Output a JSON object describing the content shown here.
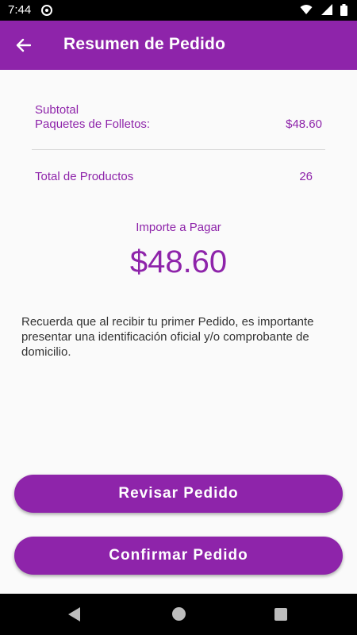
{
  "status_bar": {
    "time": "7:44",
    "icons": [
      "app-notification-icon",
      "wifi-icon",
      "signal-icon",
      "battery-icon"
    ]
  },
  "app_bar": {
    "title": "Resumen de Pedido",
    "back_icon": "arrow-back-icon",
    "background_color": "#8e24aa"
  },
  "summary": {
    "subtotal_label": "Subtotal",
    "packages_label": "Paquetes de Folletos:",
    "packages_amount": "$48.60",
    "total_products_label": "Total de Productos",
    "total_products_value": "26"
  },
  "payment": {
    "caption": "Importe a Pagar",
    "amount": "$48.60"
  },
  "notice": {
    "text": "Recuerda que al recibir tu primer Pedido, es importante presentar una identificación oficial y/o comprobante de domicilio."
  },
  "actions": {
    "review_label": "Revisar Pedido",
    "confirm_label": "Confirmar Pedido"
  },
  "nav_bar": {
    "icons": [
      "nav-back-icon",
      "nav-home-icon",
      "nav-recents-icon"
    ]
  },
  "colors": {
    "accent": "#8e24aa",
    "text_dark": "#333333"
  }
}
